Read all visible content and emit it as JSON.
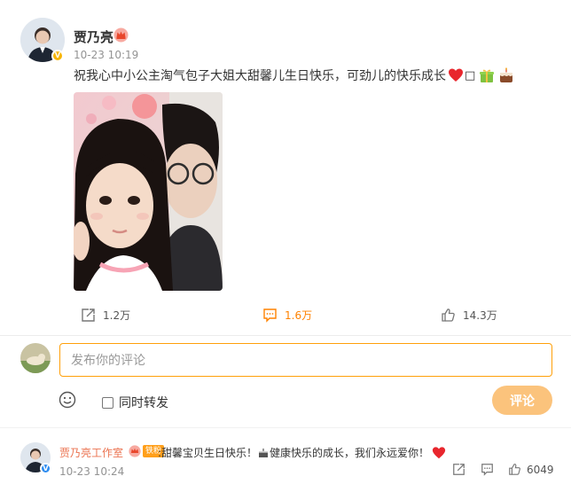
{
  "post": {
    "author": "贾乃亮",
    "time": "10-23 10:19",
    "text": "祝我心中小公主淘气包子大姐大甜馨儿生日快乐，可劲儿的快乐成长",
    "text_tail": "□"
  },
  "actions": {
    "repost_count": "1.2万",
    "comment_count": "1.6万",
    "like_count": "14.3万"
  },
  "comment_box": {
    "placeholder": "发布你的评论",
    "repost_label": "同时转发",
    "submit_label": "评论"
  },
  "comment": {
    "author": "贾乃亮工作室",
    "fan_badge": "铁粉",
    "text_a": ":甜馨宝贝生日快乐！",
    "text_b": "健康快乐的成长，我们永远爱你！",
    "time": "10-23 10:24",
    "like_count": "6049"
  },
  "colors": {
    "accent": "#ff8200",
    "input_border": "#ffa00a",
    "submit_bg": "#fbc37c",
    "comment_author": "#eb7350",
    "verified_gold": "#f8b500",
    "verified_blue": "#2d8cf0"
  },
  "icons": {
    "repost": "repost-icon",
    "comment": "comment-icon",
    "like": "thumbs-up-icon",
    "emoji": "smiley-icon"
  }
}
